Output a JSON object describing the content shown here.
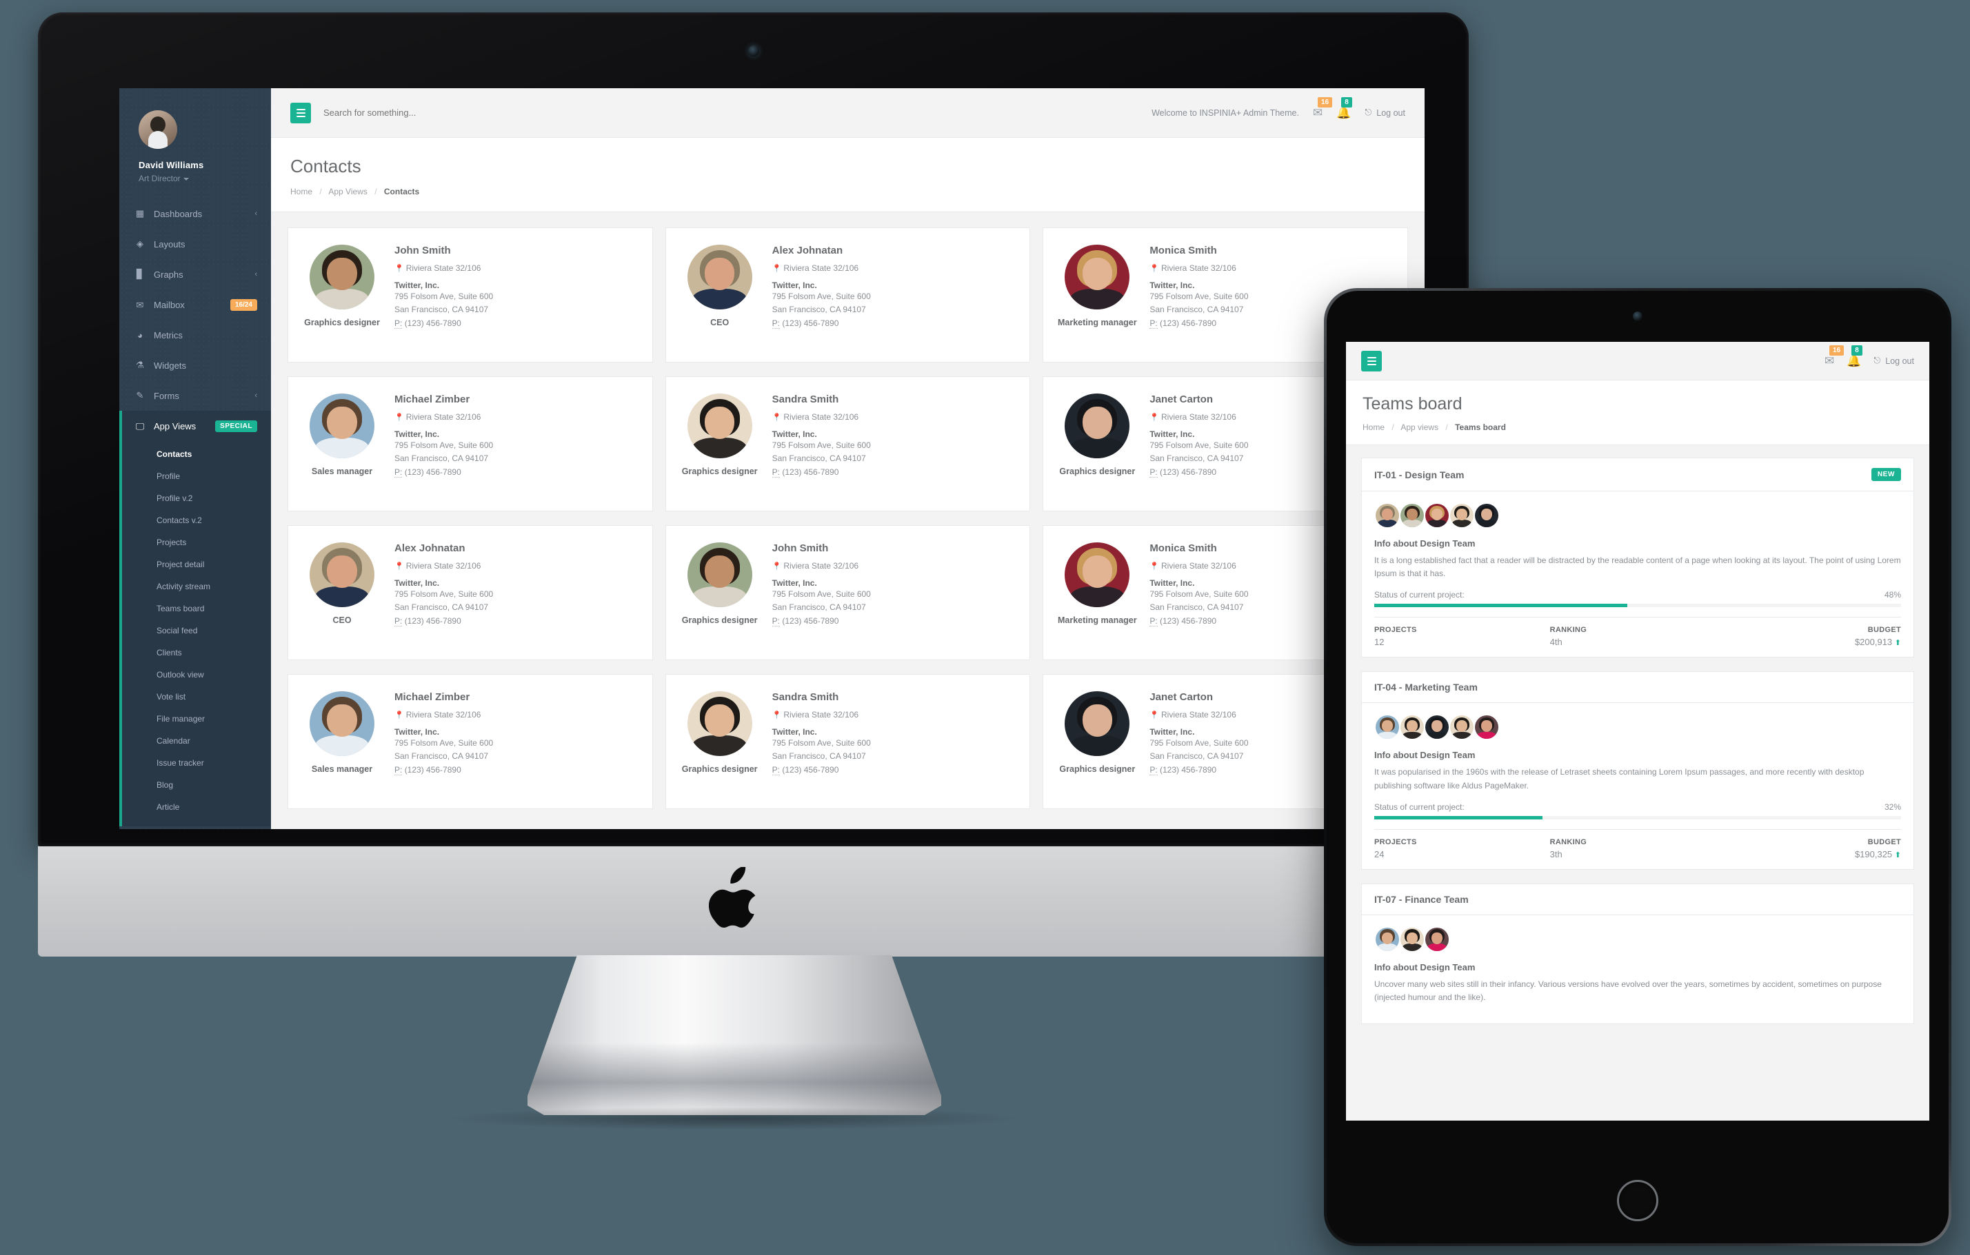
{
  "desktop": {
    "sidebar": {
      "profile": {
        "name": "David Williams",
        "role": "Art Director"
      },
      "items": [
        {
          "label": "Dashboards",
          "icon": "grid-icon",
          "arrow": "‹",
          "badge": null
        },
        {
          "label": "Layouts",
          "icon": "diamond-icon",
          "arrow": "",
          "badge": null
        },
        {
          "label": "Graphs",
          "icon": "bar-chart-icon",
          "arrow": "‹",
          "badge": null
        },
        {
          "label": "Mailbox",
          "icon": "envelope-icon",
          "arrow": "",
          "badge": "16/24",
          "badge_type": "warn"
        },
        {
          "label": "Metrics",
          "icon": "pie-chart-icon",
          "arrow": "",
          "badge": null
        },
        {
          "label": "Widgets",
          "icon": "flask-icon",
          "arrow": "",
          "badge": null
        },
        {
          "label": "Forms",
          "icon": "pencil-square-icon",
          "arrow": "‹",
          "badge": null
        },
        {
          "label": "App Views",
          "icon": "desktop-icon",
          "arrow": "",
          "badge": "SPECIAL",
          "badge_type": "success",
          "active": true
        }
      ],
      "subitems": [
        "Contacts",
        "Profile",
        "Profile v.2",
        "Contacts v.2",
        "Projects",
        "Project detail",
        "Activity stream",
        "Teams board",
        "Social feed",
        "Clients",
        "Outlook view",
        "Vote list",
        "File manager",
        "Calendar",
        "Issue tracker",
        "Blog",
        "Article"
      ],
      "active_subitem": "Contacts"
    },
    "navbar": {
      "search_placeholder": "Search for something...",
      "welcome": "Welcome to INSPINIA+ Admin Theme.",
      "mail_badge": "16",
      "bell_badge": "8",
      "logout": "Log out"
    },
    "page": {
      "title": "Contacts",
      "breadcrumb": [
        "Home",
        "App Views",
        "Contacts"
      ]
    },
    "contacts": [
      {
        "name": "John Smith",
        "role": "Graphics designer",
        "address": "Riviera State 32/106",
        "org": "Twitter, Inc.",
        "street": "795 Folsom Ave, Suite 600",
        "city": "San Francisco, CA 94107",
        "phone_label": "P:",
        "phone": "(123) 456-7890",
        "face": "m1"
      },
      {
        "name": "Alex Johnatan",
        "role": "CEO",
        "address": "Riviera State 32/106",
        "org": "Twitter, Inc.",
        "street": "795 Folsom Ave, Suite 600",
        "city": "San Francisco, CA 94107",
        "phone_label": "P:",
        "phone": "(123) 456-7890",
        "face": "m2"
      },
      {
        "name": "Monica Smith",
        "role": "Marketing manager",
        "address": "Riviera State 32/106",
        "org": "Twitter, Inc.",
        "street": "795 Folsom Ave, Suite 600",
        "city": "San Francisco, CA 94107",
        "phone_label": "P:",
        "phone": "(123) 456-7890",
        "face": "f1"
      },
      {
        "name": "Michael Zimber",
        "role": "Sales manager",
        "address": "Riviera State 32/106",
        "org": "Twitter, Inc.",
        "street": "795 Folsom Ave, Suite 600",
        "city": "San Francisco, CA 94107",
        "phone_label": "P:",
        "phone": "(123) 456-7890",
        "face": "m3"
      },
      {
        "name": "Sandra Smith",
        "role": "Graphics designer",
        "address": "Riviera State 32/106",
        "org": "Twitter, Inc.",
        "street": "795 Folsom Ave, Suite 600",
        "city": "San Francisco, CA 94107",
        "phone_label": "P:",
        "phone": "(123) 456-7890",
        "face": "f2"
      },
      {
        "name": "Janet Carton",
        "role": "Graphics designer",
        "address": "Riviera State 32/106",
        "org": "Twitter, Inc.",
        "street": "795 Folsom Ave, Suite 600",
        "city": "San Francisco, CA 94107",
        "phone_label": "P:",
        "phone": "(123) 456-7890",
        "face": "f3"
      },
      {
        "name": "Alex Johnatan",
        "role": "CEO",
        "address": "Riviera State 32/106",
        "org": "Twitter, Inc.",
        "street": "795 Folsom Ave, Suite 600",
        "city": "San Francisco, CA 94107",
        "phone_label": "P:",
        "phone": "(123) 456-7890",
        "face": "m2"
      },
      {
        "name": "John Smith",
        "role": "Graphics designer",
        "address": "Riviera State 32/106",
        "org": "Twitter, Inc.",
        "street": "795 Folsom Ave, Suite 600",
        "city": "San Francisco, CA 94107",
        "phone_label": "P:",
        "phone": "(123) 456-7890",
        "face": "m1"
      },
      {
        "name": "Monica Smith",
        "role": "Marketing manager",
        "address": "Riviera State 32/106",
        "org": "Twitter, Inc.",
        "street": "795 Folsom Ave, Suite 600",
        "city": "San Francisco, CA 94107",
        "phone_label": "P:",
        "phone": "(123) 456-7890",
        "face": "f1"
      },
      {
        "name": "Michael Zimber",
        "role": "Sales manager",
        "address": "Riviera State 32/106",
        "org": "Twitter, Inc.",
        "street": "795 Folsom Ave, Suite 600",
        "city": "San Francisco, CA 94107",
        "phone_label": "P:",
        "phone": "(123) 456-7890",
        "face": "m3"
      },
      {
        "name": "Sandra Smith",
        "role": "Graphics designer",
        "address": "Riviera State 32/106",
        "org": "Twitter, Inc.",
        "street": "795 Folsom Ave, Suite 600",
        "city": "San Francisco, CA 94107",
        "phone_label": "P:",
        "phone": "(123) 456-7890",
        "face": "f2"
      },
      {
        "name": "Janet Carton",
        "role": "Graphics designer",
        "address": "Riviera State 32/106",
        "org": "Twitter, Inc.",
        "street": "795 Folsom Ave, Suite 600",
        "city": "San Francisco, CA 94107",
        "phone_label": "P:",
        "phone": "(123) 456-7890",
        "face": "f3"
      }
    ]
  },
  "tablet": {
    "navbar": {
      "mail_badge": "16",
      "bell_badge": "8",
      "logout": "Log out"
    },
    "page": {
      "title": "Teams board",
      "breadcrumb": [
        "Home",
        "App views",
        "Teams board"
      ]
    },
    "labels": {
      "status": "Status of current project:",
      "projects": "PROJECTS",
      "ranking": "RANKING",
      "budget": "BUDGET",
      "new": "NEW"
    },
    "teams": [
      {
        "title": "IT-01 - Design Team",
        "badge": "NEW",
        "subtitle": "Info about Design Team",
        "desc": "It is a long established fact that a reader will be distracted by the readable content of a page when looking at its layout. The point of using Lorem Ipsum is that it has.",
        "status_pct": "48%",
        "progress": 48,
        "projects": "12",
        "ranking": "4th",
        "budget": "$200,913",
        "members": [
          "m2",
          "m1",
          "f1",
          "f2",
          "f3"
        ]
      },
      {
        "title": "IT-04 - Marketing Team",
        "badge": null,
        "subtitle": "Info about Design Team",
        "desc": "It was popularised in the 1960s with the release of Letraset sheets containing Lorem Ipsum passages, and more recently with desktop publishing software like Aldus PageMaker.",
        "status_pct": "32%",
        "progress": 32,
        "projects": "24",
        "ranking": "3th",
        "budget": "$190,325",
        "members": [
          "m3",
          "f2",
          "f3",
          "f2",
          "f4"
        ]
      },
      {
        "title": "IT-07 - Finance Team",
        "badge": null,
        "subtitle": "Info about Design Team",
        "desc": "Uncover many web sites still in their infancy. Various versions have evolved over the years, sometimes by accident, sometimes on purpose (injected humour and the like).",
        "status_pct": null,
        "progress": null,
        "projects": null,
        "ranking": null,
        "budget": null,
        "members": [
          "m3",
          "f2",
          "f4"
        ]
      }
    ]
  },
  "colors": {
    "accent": "#1ab394",
    "warn": "#f8ac59",
    "sidebar": "#2f4050",
    "sidebar_active": "#293846",
    "page_bg": "#f3f3f4",
    "text": "#676a6c",
    "muted": "#8a8f94",
    "desk_bg": "#4c6470"
  }
}
